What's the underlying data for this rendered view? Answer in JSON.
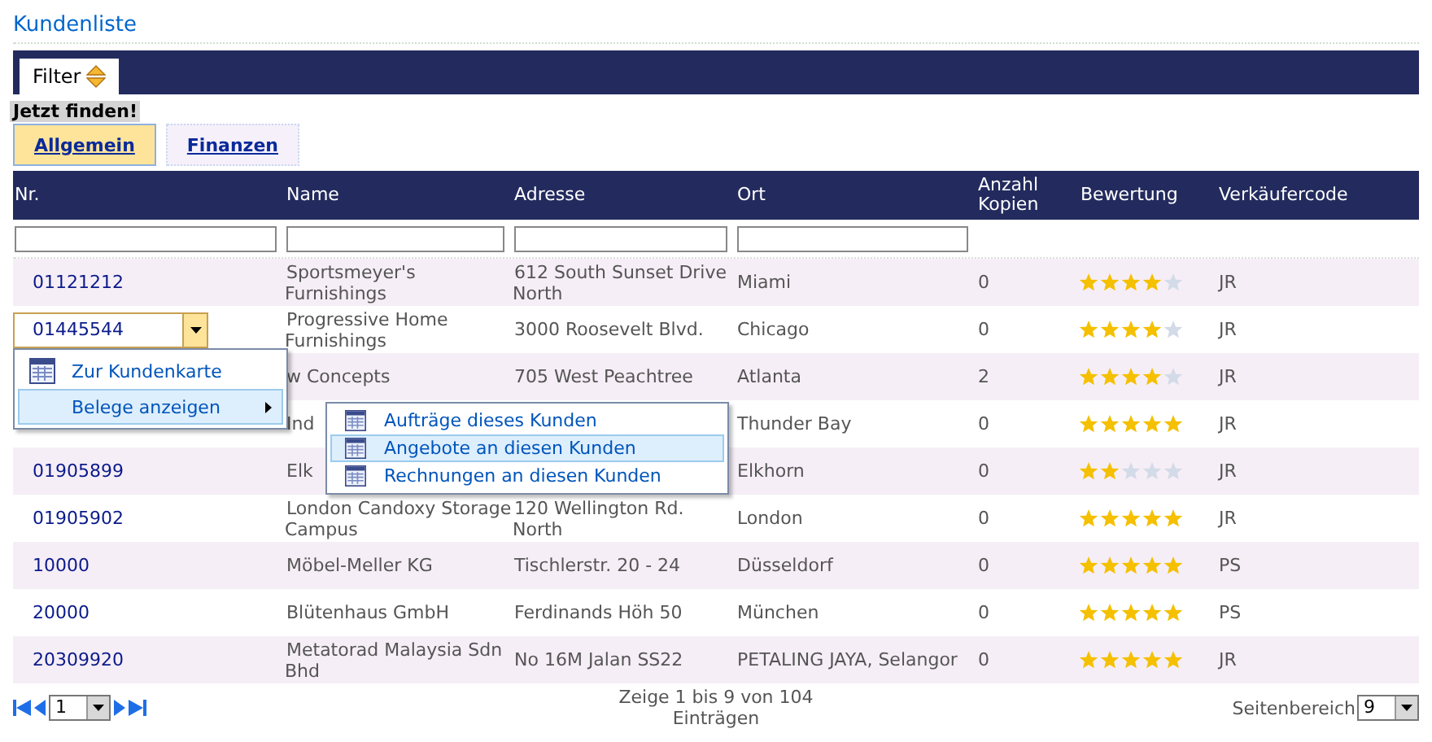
{
  "page_title": "Kundenliste",
  "filter_tab": {
    "label": "Filter",
    "selected": true
  },
  "find_label": "Jetzt finden!",
  "tabs": [
    {
      "label": "Allgemein",
      "selected": true
    },
    {
      "label": "Finanzen",
      "selected": false
    }
  ],
  "table": {
    "columns": [
      {
        "label": "Nr.",
        "filterable": true
      },
      {
        "label": "Name",
        "filterable": true
      },
      {
        "label": "Adresse",
        "filterable": true
      },
      {
        "label": "Ort",
        "filterable": true
      },
      {
        "label": "Anzahl Kopien",
        "filterable": false
      },
      {
        "label": "Bewertung",
        "filterable": false
      },
      {
        "label": "Verkäufercode",
        "filterable": false
      }
    ],
    "rows": [
      {
        "nr": "01121212",
        "name": "Sportsmeyer's Furnishings",
        "address": "612 South Sunset Drive North",
        "city": "Miami",
        "copies": "0",
        "stars": 4,
        "seller": "JR",
        "selected": false
      },
      {
        "nr": "01445544",
        "name": "Progressive Home Furnishings",
        "address": "3000 Roosevelt Blvd.",
        "city": "Chicago",
        "copies": "0",
        "stars": 4,
        "seller": "JR",
        "selected": true
      },
      {
        "name": "w Concepts",
        "address": "705 West Peachtree",
        "city": "Atlanta",
        "copies": "2",
        "stars": 4,
        "seller": "JR"
      },
      {
        "name": "Ind",
        "city": "Thunder Bay",
        "copies": "0",
        "stars": 5,
        "seller": "JR",
        "selected": false
      },
      {
        "nr": "01905899",
        "name": "Elk",
        "city": "Elkhorn",
        "copies": "0",
        "stars": 2,
        "seller": "JR",
        "selected": false
      },
      {
        "nr": "01905902",
        "name": "London Candoxy Storage Campus",
        "address": "120 Wellington Rd. North",
        "city": "London",
        "copies": "0",
        "stars": 5,
        "seller": "JR",
        "selected": false
      },
      {
        "nr": "10000",
        "name": "Möbel-Meller KG",
        "address": "Tischlerstr. 20 - 24",
        "city": "Düsseldorf",
        "copies": "0",
        "stars": 5,
        "seller": "PS",
        "selected": false
      },
      {
        "nr": "20000",
        "name": "Blütenhaus GmbH",
        "address": "Ferdinands Höh 50",
        "city": "München",
        "copies": "0",
        "stars": 5,
        "seller": "PS",
        "selected": false
      },
      {
        "nr": "20309920",
        "name": "Metatorad Malaysia Sdn Bhd",
        "address": "No 16M Jalan SS22",
        "city": "PETALING JAYA, Selangor",
        "copies": "0",
        "stars": 5,
        "seller": "JR",
        "selected": false
      }
    ]
  },
  "context_menu": {
    "items": [
      {
        "label": "Zur Kundenkarte",
        "icon": true,
        "has_submenu": false,
        "selected": false
      },
      {
        "label": "Belege anzeigen",
        "icon": false,
        "has_submenu": true,
        "selected": true
      }
    ],
    "submenu": [
      {
        "label": "Aufträge dieses Kunden",
        "selected": false
      },
      {
        "label": "Angebote an diesen Kunden",
        "selected": true
      },
      {
        "label": "Rechnungen an diesen Kunden",
        "selected": false
      }
    ]
  },
  "pager": {
    "page": "1",
    "summary": "Zeige 1 bis 9 von 104 Einträgen",
    "page_size_label": "Seitenbereich",
    "page_size": "9"
  }
}
